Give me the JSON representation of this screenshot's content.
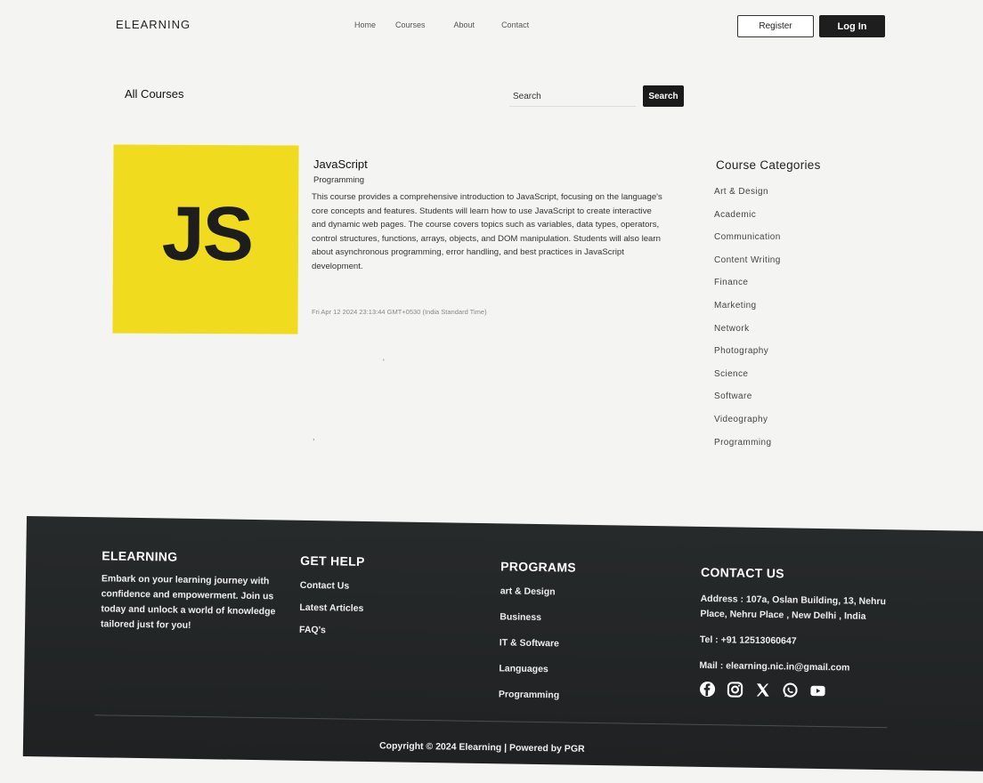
{
  "header": {
    "brand": "ELEARNING",
    "nav": [
      "Home",
      "Courses",
      "About",
      "Contact"
    ],
    "register_label": "Register",
    "login_label": "Log In"
  },
  "toolbar": {
    "heading": "All Courses",
    "search_placeholder": "Search",
    "search_button": "Search"
  },
  "course": {
    "thumb_text": "JS",
    "thumb_color": "#f0db1e",
    "title": "JavaScript",
    "category": "Programming",
    "description": "This course provides a comprehensive introduction to JavaScript, focusing on the language's core concepts and features. Students will learn how to use JavaScript to create interactive and dynamic web pages. The course covers topics such as variables, data types, operators, control structures, functions, arrays, objects, and DOM manipulation. Students will also learn about asynchronous programming, error handling, and best practices in JavaScript development.",
    "date": "Fri Apr 12 2024 23:13:44 GMT+0530 (India Standard Time)"
  },
  "categories": {
    "title": "Course Categories",
    "items": [
      "Art & Design",
      "Academic",
      "Communication",
      "Content Writing",
      "Finance",
      "Marketing",
      "Network",
      "Photography",
      "Science",
      "Software",
      "Videography",
      "Programming"
    ]
  },
  "footer": {
    "brand": {
      "heading": "ELEARNING",
      "text": "Embark on your learning journey with confidence and empowerment. Join us today and unlock a world of knowledge tailored just for you!"
    },
    "help": {
      "heading": "GET HELP",
      "links": [
        "Contact Us",
        "Latest Articles",
        "FAQ's"
      ]
    },
    "programs": {
      "heading": "PROGRAMS",
      "links": [
        "art & Design",
        "Business",
        "IT & Software",
        "Languages",
        "Programming"
      ]
    },
    "contact": {
      "heading": "CONTACT US",
      "address": "Address : 107a, Oslan Building, 13, Nehru Place, Nehru Place , New Delhi , India",
      "tel": "Tel : +91 12513060647",
      "mail": "Mail : elearning.nic.in@gmail.com",
      "social_icons": [
        "facebook-icon",
        "instagram-icon",
        "x-icon",
        "whatsapp-icon",
        "youtube-icon"
      ]
    },
    "copyright": "Copyright © 2024 Elearning | Powered by PGR",
    "background": "#232526"
  }
}
